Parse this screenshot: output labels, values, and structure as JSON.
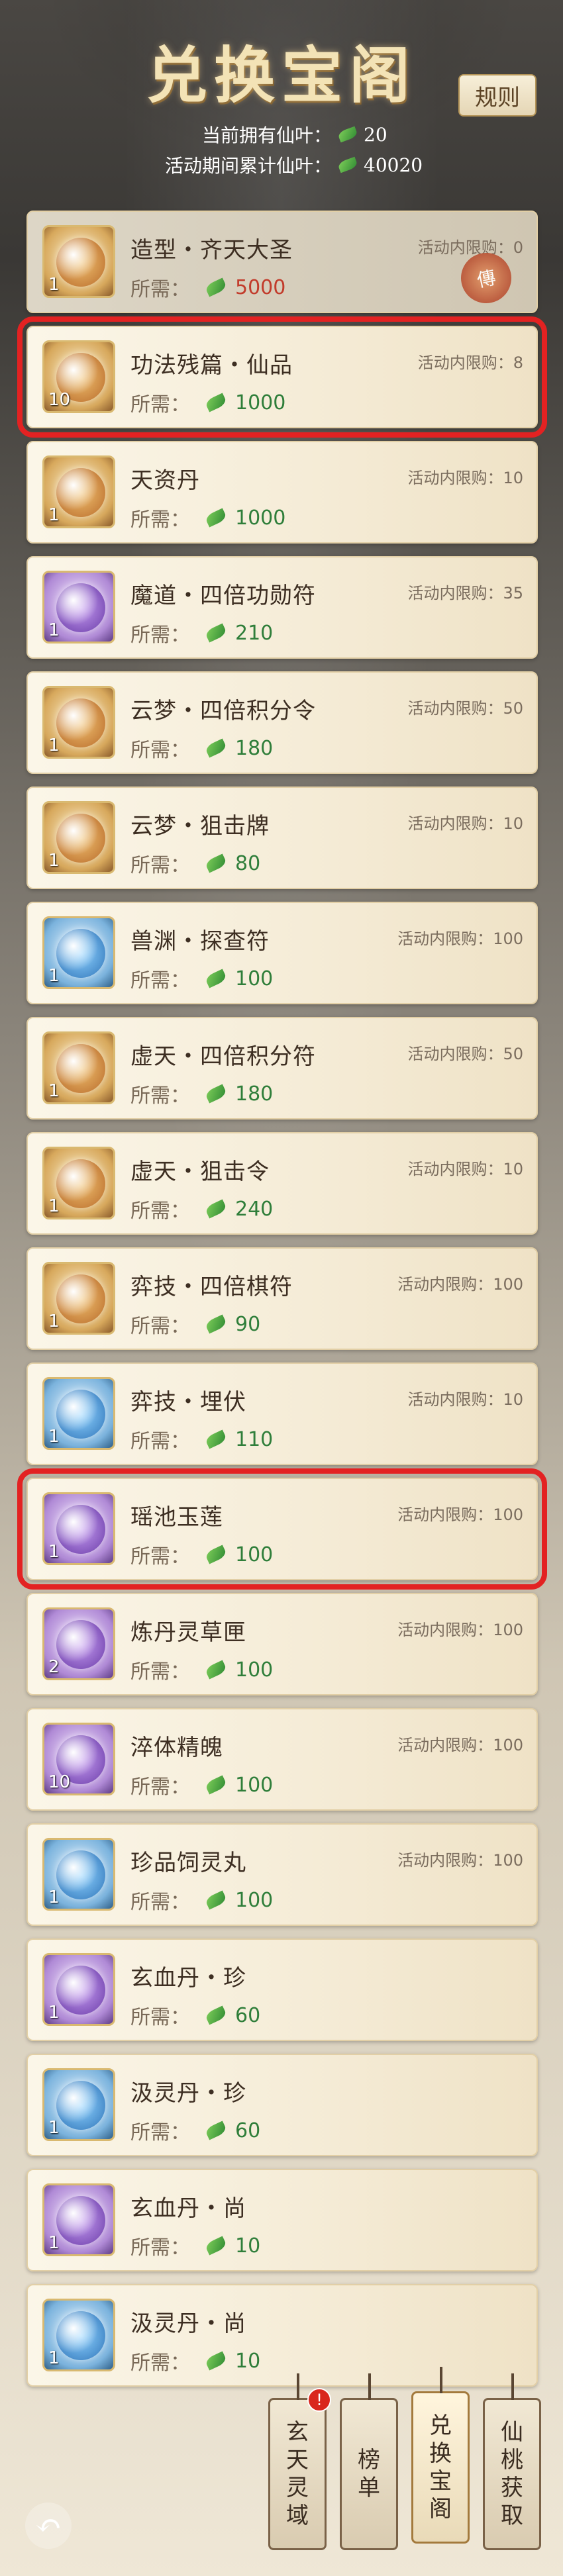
{
  "header": {
    "title": "兑换宝阁",
    "rules_label": "规则",
    "current_label": "当前拥有仙叶：",
    "current_value": "20",
    "total_label": "活动期间累计仙叶：",
    "total_value": "40020"
  },
  "limit_prefix": "活动内限购：",
  "cost_label": "所需：",
  "items": [
    {
      "name": "造型・齐天大圣",
      "limit": "0",
      "cost": "5000",
      "qty": "1",
      "stamp": "傳"
    },
    {
      "name": "功法残篇・仙品",
      "limit": "8",
      "cost": "1000",
      "qty": "10"
    },
    {
      "name": "天资丹",
      "limit": "10",
      "cost": "1000",
      "qty": "1"
    },
    {
      "name": "魔道・四倍功勋符",
      "limit": "35",
      "cost": "210",
      "qty": "1"
    },
    {
      "name": "云梦・四倍积分令",
      "limit": "50",
      "cost": "180",
      "qty": "1"
    },
    {
      "name": "云梦・狙击牌",
      "limit": "10",
      "cost": "80",
      "qty": "1"
    },
    {
      "name": "兽渊・探查符",
      "limit": "100",
      "cost": "100",
      "qty": "1"
    },
    {
      "name": "虚天・四倍积分符",
      "limit": "50",
      "cost": "180",
      "qty": "1"
    },
    {
      "name": "虚天・狙击令",
      "limit": "10",
      "cost": "240",
      "qty": "1"
    },
    {
      "name": "弈技・四倍棋符",
      "limit": "100",
      "cost": "90",
      "qty": "1"
    },
    {
      "name": "弈技・埋伏",
      "limit": "10",
      "cost": "110",
      "qty": "1"
    },
    {
      "name": "瑶池玉莲",
      "limit": "100",
      "cost": "100",
      "qty": "1"
    },
    {
      "name": "炼丹灵草匣",
      "limit": "100",
      "cost": "100",
      "qty": "2"
    },
    {
      "name": "淬体精魄",
      "limit": "100",
      "cost": "100",
      "qty": "10"
    },
    {
      "name": "珍品饲灵丸",
      "limit": "100",
      "cost": "100",
      "qty": "1"
    },
    {
      "name": "玄血丹・珍",
      "limit": "",
      "cost": "60",
      "qty": "1"
    },
    {
      "name": "汲灵丹・珍",
      "limit": "",
      "cost": "60",
      "qty": "1"
    },
    {
      "name": "玄血丹・尚",
      "limit": "",
      "cost": "10",
      "qty": "1"
    },
    {
      "name": "汲灵丹・尚",
      "limit": "",
      "cost": "10",
      "qty": "1"
    }
  ],
  "nav": {
    "back_symbol": "↶",
    "tags": [
      {
        "label": "玄天灵域",
        "alert": "!"
      },
      {
        "label": "榜单"
      },
      {
        "label": "兑换宝阁"
      },
      {
        "label": "仙桃获取"
      }
    ]
  },
  "colors": {
    "highlight": "#e32222",
    "accent": "#2f7e3a"
  }
}
